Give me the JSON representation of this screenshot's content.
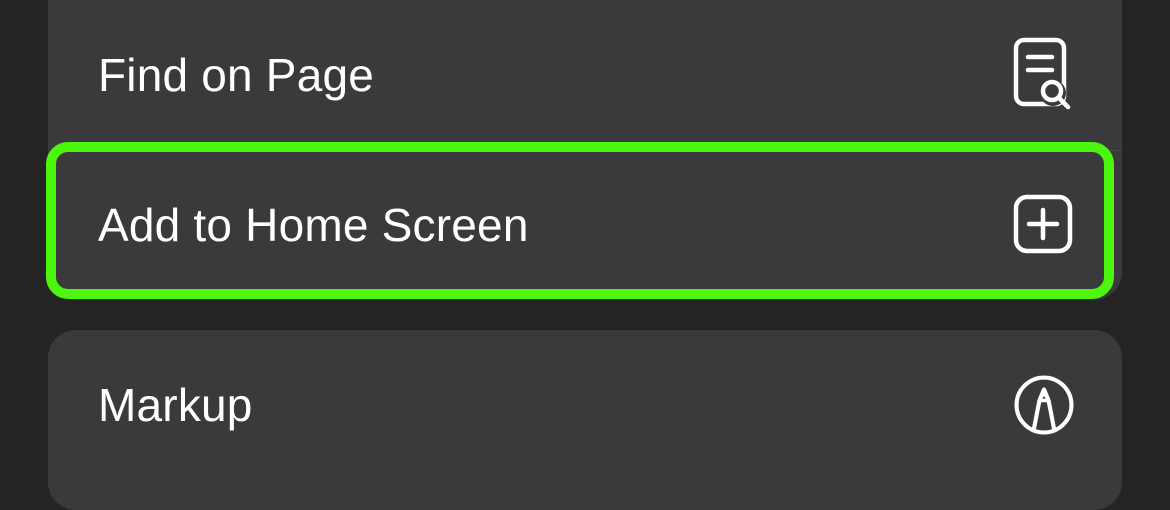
{
  "menu": {
    "items": [
      {
        "label": "Find on Page",
        "icon": "find-on-page-icon"
      },
      {
        "label": "Add to Home Screen",
        "icon": "add-square-icon"
      },
      {
        "label": "Markup",
        "icon": "markup-pen-icon"
      }
    ],
    "highlight_color": "#4cf60e"
  }
}
